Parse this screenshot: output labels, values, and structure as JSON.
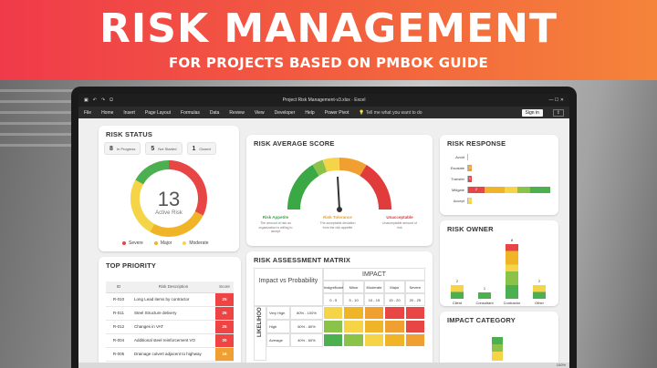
{
  "banner": {
    "title": "RISK MANAGEMENT",
    "subtitle": "FOR PROJECTS BASED ON PMBOK GUIDE"
  },
  "excel": {
    "window_title": "Project Risk Management-v3.xlsx  ·  Excel",
    "ribbon_tabs": [
      "File",
      "Home",
      "Insert",
      "Page Layout",
      "Formulas",
      "Data",
      "Review",
      "View",
      "Developer",
      "Help",
      "Power Pivot"
    ],
    "tell_me": "Tell me what you want to do",
    "sign_in": "Sign in",
    "zoom": "100%"
  },
  "risk_status": {
    "title": "RISK STATUS",
    "pills": [
      {
        "count": "8",
        "label": "In Progress"
      },
      {
        "count": "5",
        "label": "Not Started"
      },
      {
        "count": "1",
        "label": "Closed"
      }
    ],
    "active_count": "13",
    "active_label": "Active Risk",
    "legend": [
      {
        "label": "Severe",
        "color": "#e84545"
      },
      {
        "label": "Major",
        "color": "#f0b429"
      },
      {
        "label": "Moderate",
        "color": "#f5d547"
      }
    ]
  },
  "risk_average_score": {
    "title": "RISK AVERAGE SCORE",
    "zones": [
      {
        "label": "Risk Appetite",
        "desc": "The amount of risk an organization is willing to accept",
        "color": "#3aa845"
      },
      {
        "label": "Risk Tolerance",
        "desc": "The acceptable deviation from the risk appetite",
        "color": "#e8a020"
      },
      {
        "label": "Unacceptable",
        "desc": "Unacceptable amount of risk",
        "color": "#e03c3c"
      }
    ]
  },
  "risk_response": {
    "title": "RISK RESPONSE",
    "rows": [
      {
        "label": "Avoid",
        "segments": []
      },
      {
        "label": "Escalate",
        "segments": [
          {
            "value": "1",
            "color": "#f0a030",
            "w": 4
          }
        ]
      },
      {
        "label": "Transfer",
        "segments": [
          {
            "value": "1",
            "color": "#e84545",
            "w": 4
          }
        ]
      },
      {
        "label": "Mitigate",
        "segments": [
          {
            "value": "2",
            "color": "#e84545",
            "w": 18
          },
          {
            "value": "",
            "color": "#f0b429",
            "w": 22
          },
          {
            "value": "",
            "color": "#f5d547",
            "w": 14
          },
          {
            "value": "",
            "color": "#8bc34a",
            "w": 14
          },
          {
            "value": "",
            "color": "#4caf50",
            "w": 22
          }
        ]
      },
      {
        "label": "Accept",
        "segments": [
          {
            "value": "1",
            "color": "#f5d547",
            "w": 4
          }
        ]
      }
    ]
  },
  "risk_owner": {
    "title": "RISK OWNER",
    "bars": [
      {
        "label": "Client",
        "value": "2",
        "height": 2
      },
      {
        "label": "Consultant",
        "value": "1",
        "height": 1
      },
      {
        "label": "Contractor",
        "value": "8",
        "height": 8
      },
      {
        "label": "Other",
        "value": "2",
        "height": 2
      }
    ]
  },
  "impact_category": {
    "title": "IMPACT CATEGORY"
  },
  "top_priority": {
    "title": "TOP PRIORITY",
    "columns": [
      "ID",
      "Risk Description",
      "Score"
    ],
    "rows": [
      {
        "id": "R-010",
        "desc": "Long Lead items by contractor",
        "score": "25"
      },
      {
        "id": "R-011",
        "desc": "Steel Structure delivery",
        "score": "25"
      },
      {
        "id": "R-012",
        "desc": "Changes in VAT",
        "score": "25"
      },
      {
        "id": "R-004",
        "desc": "Additional steel reinforcement VO",
        "score": "20"
      },
      {
        "id": "R-005",
        "desc": "Drainage culvert adjacent to highway",
        "score": "16"
      }
    ]
  },
  "matrix": {
    "title": "RISK ASSESSMENT MATRIX",
    "impact_label": "IMPACT",
    "corner_label": "Impact vs Probability",
    "likelihood_label": "LIKELIHOOD",
    "impact_cols": [
      {
        "name": "Insignificant",
        "range": "0 - 5"
      },
      {
        "name": "Minor",
        "range": "5 - 10"
      },
      {
        "name": "Moderate",
        "range": "10 - 15"
      },
      {
        "name": "Major",
        "range": "15 - 20"
      },
      {
        "name": "Severe",
        "range": "20 - 25"
      }
    ],
    "rows": [
      {
        "name": "Very High",
        "range": "80% - 100%"
      },
      {
        "name": "High",
        "range": "60% - 80%"
      },
      {
        "name": "Average",
        "range": "40% - 60%"
      }
    ]
  }
}
